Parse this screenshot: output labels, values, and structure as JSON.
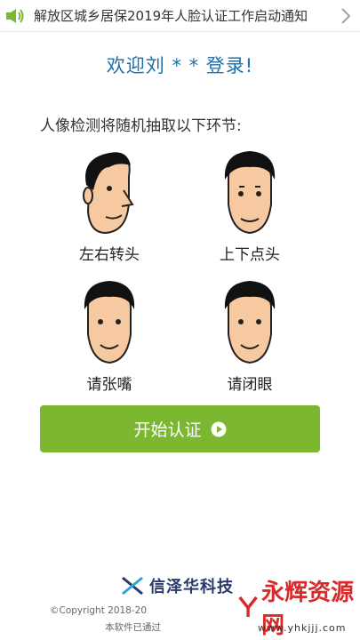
{
  "notice": {
    "text": "解放区城乡居保2019年人脸认证工作启动通知",
    "icon": "speaker-icon",
    "chevron_icon": "chevron-right-icon",
    "accent": "#7cb82f"
  },
  "welcome": "欢迎刘 * * 登录!",
  "intro": "人像检测将随机抽取以下环节:",
  "actions": [
    {
      "label": "左右转头",
      "icon": "turn-head-face-icon"
    },
    {
      "label": "上下点头",
      "icon": "nod-head-face-icon"
    },
    {
      "label": "请张嘴",
      "icon": "open-mouth-face-icon"
    },
    {
      "label": "请闭眼",
      "icon": "close-eyes-face-icon"
    }
  ],
  "start_button": {
    "label": "开始认证",
    "icon": "play-circle-icon",
    "color": "#7cb82f"
  },
  "footer": {
    "brand": "信泽华科技",
    "copyright": "©Copyright 2018-20",
    "certification": "本软件已通过",
    "logo_icon": "xinzehua-logo-icon"
  },
  "watermark": {
    "text": "永辉资源网",
    "url": "www.yhkjjj.com",
    "color": "#d82a2a"
  }
}
